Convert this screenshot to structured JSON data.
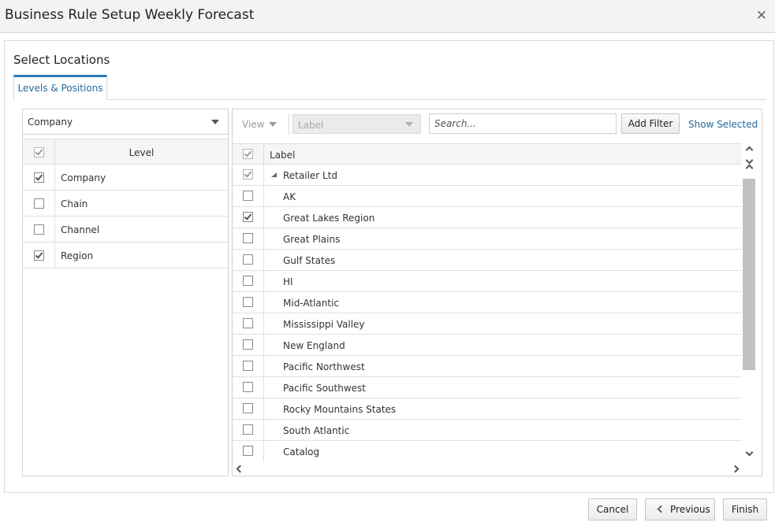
{
  "window": {
    "title": "Business Rule Setup Weekly Forecast"
  },
  "section": {
    "title": "Select Locations"
  },
  "tabs": [
    {
      "label": "Levels & Positions",
      "active": true
    }
  ],
  "levels": {
    "dropdown_value": "Company",
    "header": "Level",
    "rows": [
      {
        "label": "Company",
        "checked": true
      },
      {
        "label": "Chain",
        "checked": false
      },
      {
        "label": "Channel",
        "checked": false
      },
      {
        "label": "Region",
        "checked": true
      }
    ]
  },
  "positions": {
    "toolbar": {
      "view_label": "View",
      "label_select": "Label",
      "search_placeholder": "Search...",
      "add_filter": "Add Filter",
      "show_selected": "Show Selected"
    },
    "header": "Label",
    "root": {
      "label": "Retailer Ltd",
      "checked": true
    },
    "rows": [
      {
        "label": "AK",
        "checked": false
      },
      {
        "label": "Great Lakes Region",
        "checked": true
      },
      {
        "label": "Great Plains",
        "checked": false
      },
      {
        "label": "Gulf States",
        "checked": false
      },
      {
        "label": "HI",
        "checked": false
      },
      {
        "label": "Mid-Atlantic",
        "checked": false
      },
      {
        "label": "Mississippi Valley",
        "checked": false
      },
      {
        "label": "New England",
        "checked": false
      },
      {
        "label": "Pacific Northwest",
        "checked": false
      },
      {
        "label": "Pacific Southwest",
        "checked": false
      },
      {
        "label": "Rocky Mountains States",
        "checked": false
      },
      {
        "label": "South Atlantic",
        "checked": false
      },
      {
        "label": "Catalog",
        "checked": false
      }
    ]
  },
  "footer": {
    "cancel": "Cancel",
    "previous": "Previous",
    "finish": "Finish"
  },
  "icons": {
    "close": "close-icon",
    "previous": "chevron-left-icon"
  },
  "colors": {
    "accent": "#2d7bb6",
    "link": "#226a9c"
  }
}
